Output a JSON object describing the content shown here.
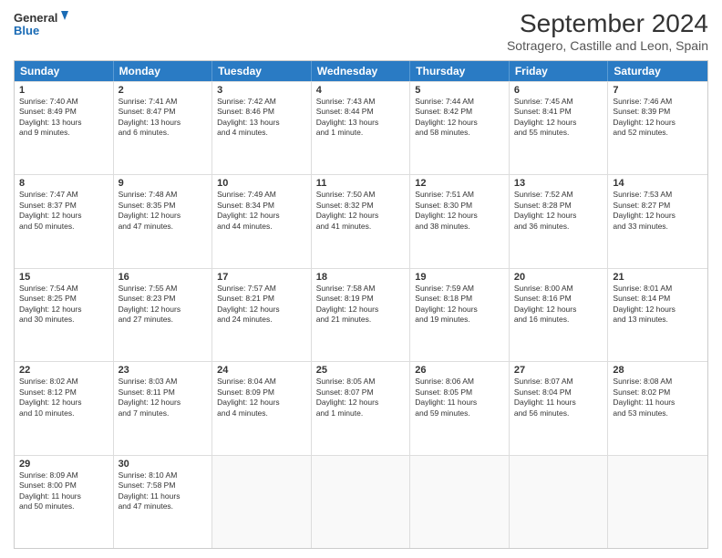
{
  "header": {
    "logo_line1": "General",
    "logo_line2": "Blue",
    "main_title": "September 2024",
    "subtitle": "Sotragero, Castille and Leon, Spain"
  },
  "calendar": {
    "days_of_week": [
      "Sunday",
      "Monday",
      "Tuesday",
      "Wednesday",
      "Thursday",
      "Friday",
      "Saturday"
    ],
    "weeks": [
      [
        {
          "day": "1",
          "info": "Sunrise: 7:40 AM\nSunset: 8:49 PM\nDaylight: 13 hours\nand 9 minutes."
        },
        {
          "day": "2",
          "info": "Sunrise: 7:41 AM\nSunset: 8:47 PM\nDaylight: 13 hours\nand 6 minutes."
        },
        {
          "day": "3",
          "info": "Sunrise: 7:42 AM\nSunset: 8:46 PM\nDaylight: 13 hours\nand 4 minutes."
        },
        {
          "day": "4",
          "info": "Sunrise: 7:43 AM\nSunset: 8:44 PM\nDaylight: 13 hours\nand 1 minute."
        },
        {
          "day": "5",
          "info": "Sunrise: 7:44 AM\nSunset: 8:42 PM\nDaylight: 12 hours\nand 58 minutes."
        },
        {
          "day": "6",
          "info": "Sunrise: 7:45 AM\nSunset: 8:41 PM\nDaylight: 12 hours\nand 55 minutes."
        },
        {
          "day": "7",
          "info": "Sunrise: 7:46 AM\nSunset: 8:39 PM\nDaylight: 12 hours\nand 52 minutes."
        }
      ],
      [
        {
          "day": "8",
          "info": "Sunrise: 7:47 AM\nSunset: 8:37 PM\nDaylight: 12 hours\nand 50 minutes."
        },
        {
          "day": "9",
          "info": "Sunrise: 7:48 AM\nSunset: 8:35 PM\nDaylight: 12 hours\nand 47 minutes."
        },
        {
          "day": "10",
          "info": "Sunrise: 7:49 AM\nSunset: 8:34 PM\nDaylight: 12 hours\nand 44 minutes."
        },
        {
          "day": "11",
          "info": "Sunrise: 7:50 AM\nSunset: 8:32 PM\nDaylight: 12 hours\nand 41 minutes."
        },
        {
          "day": "12",
          "info": "Sunrise: 7:51 AM\nSunset: 8:30 PM\nDaylight: 12 hours\nand 38 minutes."
        },
        {
          "day": "13",
          "info": "Sunrise: 7:52 AM\nSunset: 8:28 PM\nDaylight: 12 hours\nand 36 minutes."
        },
        {
          "day": "14",
          "info": "Sunrise: 7:53 AM\nSunset: 8:27 PM\nDaylight: 12 hours\nand 33 minutes."
        }
      ],
      [
        {
          "day": "15",
          "info": "Sunrise: 7:54 AM\nSunset: 8:25 PM\nDaylight: 12 hours\nand 30 minutes."
        },
        {
          "day": "16",
          "info": "Sunrise: 7:55 AM\nSunset: 8:23 PM\nDaylight: 12 hours\nand 27 minutes."
        },
        {
          "day": "17",
          "info": "Sunrise: 7:57 AM\nSunset: 8:21 PM\nDaylight: 12 hours\nand 24 minutes."
        },
        {
          "day": "18",
          "info": "Sunrise: 7:58 AM\nSunset: 8:19 PM\nDaylight: 12 hours\nand 21 minutes."
        },
        {
          "day": "19",
          "info": "Sunrise: 7:59 AM\nSunset: 8:18 PM\nDaylight: 12 hours\nand 19 minutes."
        },
        {
          "day": "20",
          "info": "Sunrise: 8:00 AM\nSunset: 8:16 PM\nDaylight: 12 hours\nand 16 minutes."
        },
        {
          "day": "21",
          "info": "Sunrise: 8:01 AM\nSunset: 8:14 PM\nDaylight: 12 hours\nand 13 minutes."
        }
      ],
      [
        {
          "day": "22",
          "info": "Sunrise: 8:02 AM\nSunset: 8:12 PM\nDaylight: 12 hours\nand 10 minutes."
        },
        {
          "day": "23",
          "info": "Sunrise: 8:03 AM\nSunset: 8:11 PM\nDaylight: 12 hours\nand 7 minutes."
        },
        {
          "day": "24",
          "info": "Sunrise: 8:04 AM\nSunset: 8:09 PM\nDaylight: 12 hours\nand 4 minutes."
        },
        {
          "day": "25",
          "info": "Sunrise: 8:05 AM\nSunset: 8:07 PM\nDaylight: 12 hours\nand 1 minute."
        },
        {
          "day": "26",
          "info": "Sunrise: 8:06 AM\nSunset: 8:05 PM\nDaylight: 11 hours\nand 59 minutes."
        },
        {
          "day": "27",
          "info": "Sunrise: 8:07 AM\nSunset: 8:04 PM\nDaylight: 11 hours\nand 56 minutes."
        },
        {
          "day": "28",
          "info": "Sunrise: 8:08 AM\nSunset: 8:02 PM\nDaylight: 11 hours\nand 53 minutes."
        }
      ],
      [
        {
          "day": "29",
          "info": "Sunrise: 8:09 AM\nSunset: 8:00 PM\nDaylight: 11 hours\nand 50 minutes."
        },
        {
          "day": "30",
          "info": "Sunrise: 8:10 AM\nSunset: 7:58 PM\nDaylight: 11 hours\nand 47 minutes."
        },
        {
          "day": "",
          "info": ""
        },
        {
          "day": "",
          "info": ""
        },
        {
          "day": "",
          "info": ""
        },
        {
          "day": "",
          "info": ""
        },
        {
          "day": "",
          "info": ""
        }
      ]
    ]
  }
}
